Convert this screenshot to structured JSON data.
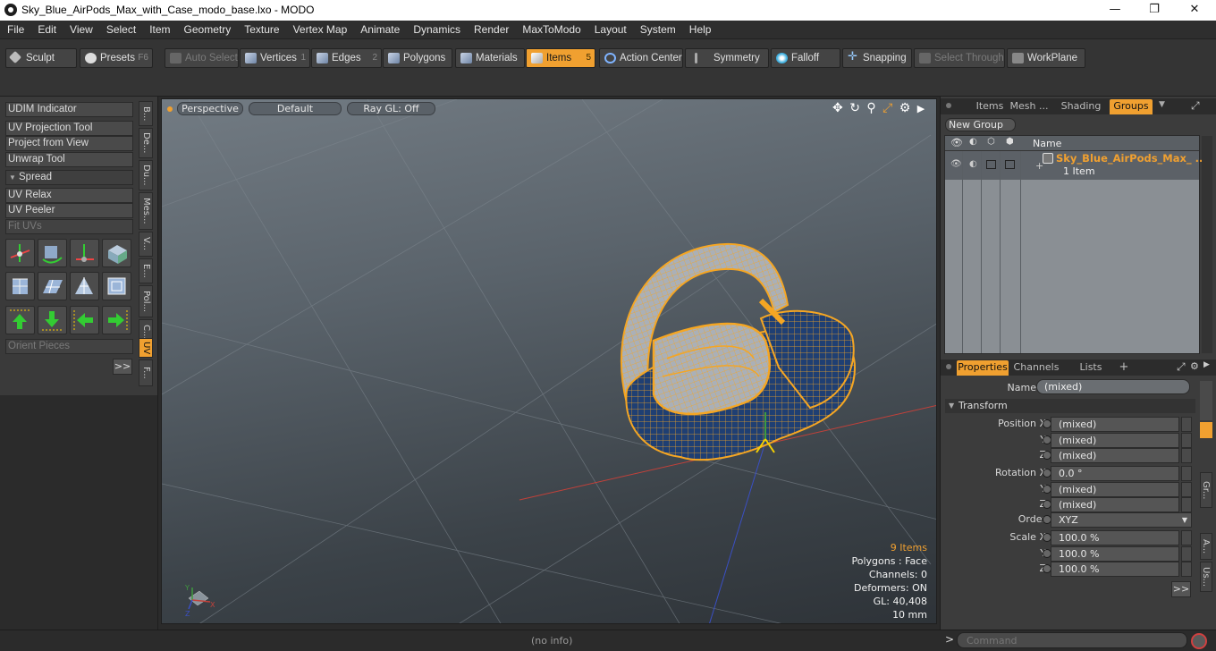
{
  "window": {
    "title": "Sky_Blue_AirPods_Max_with_Case_modo_base.lxo - MODO",
    "minimize": "—",
    "maximize": "❐",
    "close": "✕"
  },
  "menu": [
    "File",
    "Edit",
    "View",
    "Select",
    "Item",
    "Geometry",
    "Texture",
    "Vertex Map",
    "Animate",
    "Dynamics",
    "Render",
    "MaxToModo",
    "Layout",
    "System",
    "Help"
  ],
  "toolbar": {
    "sculpt": "Sculpt",
    "presets": "Presets",
    "presets_key": "F6",
    "auto_select": "Auto Select",
    "vertices": "Vertices",
    "vertices_key": "1",
    "edges": "Edges",
    "edges_key": "2",
    "polygons": "Polygons",
    "materials": "Materials",
    "items": "Items",
    "items_key": "5",
    "action_center": "Action Center",
    "symmetry": "Symmetry",
    "falloff": "Falloff",
    "snapping": "Snapping",
    "select_through": "Select Through",
    "workplane": "WorkPlane"
  },
  "left_panel": {
    "udim": "UDIM Indicator",
    "uv_projection": "UV Projection Tool",
    "project_from_view": "Project from View",
    "unwrap": "Unwrap Tool",
    "spread": "Spread",
    "uv_relax": "UV Relax",
    "uv_peeler": "UV Peeler",
    "fit_uvs": "Fit UVs",
    "orient_pieces": "Orient Pieces",
    "more": ">>",
    "vtabs": [
      "B...",
      "De...",
      "Du...",
      "Mes...",
      "V...",
      "E...",
      "Pol...",
      "C...",
      "UV",
      "F..."
    ]
  },
  "viewport": {
    "perspective": "Perspective",
    "default": "Default",
    "raygl": "Ray GL: Off",
    "info": {
      "items": "9 Items",
      "polygons": "Polygons : Face",
      "channels": "Channels: 0",
      "deformers": "Deformers: ON",
      "gl": "GL: 40,408",
      "scale": "10 mm"
    }
  },
  "items_panel": {
    "tabs": [
      "Items",
      "Mesh ...",
      "Shading",
      "Groups"
    ],
    "new_group": "New Group",
    "col_name": "Name",
    "group_name": "Sky_Blue_AirPods_Max_ ...",
    "group_count": "1 Item"
  },
  "properties": {
    "tabs": [
      "Properties",
      "Channels",
      "Lists"
    ],
    "add": "+",
    "name_label": "Name",
    "name_value": "(mixed)",
    "transform": "Transform",
    "position_x_label": "Position X",
    "position_x": "(mixed)",
    "position_y_label": "Y",
    "position_y": "(mixed)",
    "position_z_label": "Z",
    "position_z": "(mixed)",
    "rotation_x_label": "Rotation X",
    "rotation_x": "0.0 °",
    "rotation_y_label": "Y",
    "rotation_y": "(mixed)",
    "rotation_z_label": "Z",
    "rotation_z": "(mixed)",
    "order_label": "Order",
    "order_value": "XYZ",
    "scale_x_label": "Scale X",
    "scale_x": "100.0 %",
    "scale_y_label": "Y",
    "scale_y": "100.0 %",
    "scale_z_label": "Z",
    "scale_z": "100.0 %",
    "more": ">>",
    "side_tabs": [
      "Gr...",
      "A...",
      "Us..."
    ]
  },
  "status": {
    "info": "(no info)",
    "prompt": ">",
    "command_placeholder": "Command"
  },
  "colors": {
    "accent": "#f0a030",
    "wire": "#f5a623",
    "mesh_fill": "#1f3f73"
  }
}
